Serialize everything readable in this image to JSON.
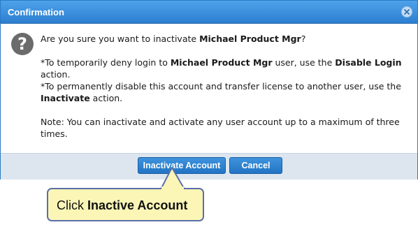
{
  "dialog": {
    "title": "Confirmation",
    "close_icon": "close-x-icon",
    "question_icon": "question-mark-icon",
    "icon_glyph": "?",
    "message": {
      "line1_prefix": "Are you sure you want to inactivate ",
      "line1_user": "Michael Product Mgr",
      "line1_suffix": "?",
      "line2_prefix": "*To temporarily deny login to ",
      "line2_user": "Michael Product Mgr",
      "line2_middle": " user, use the ",
      "line2_action": "Disable Login",
      "line2_suffix": " action.",
      "line3_prefix": "*To permanently disable this account and transfer license to another user, use the ",
      "line3_action": "Inactivate",
      "line3_suffix": " action.",
      "note": "Note: You can inactivate and activate any user account up to a maximum of three times."
    },
    "buttons": {
      "inactivate_label": "Inactivate Account",
      "cancel_label": "Cancel"
    }
  },
  "callout": {
    "prefix": "Click ",
    "bold": "Inactive Account"
  },
  "colors": {
    "titlebar": "#3a8fdc",
    "button": "#2c7fd0",
    "callout_bg": "#fbf6b6",
    "callout_border": "#5a6fa8"
  }
}
